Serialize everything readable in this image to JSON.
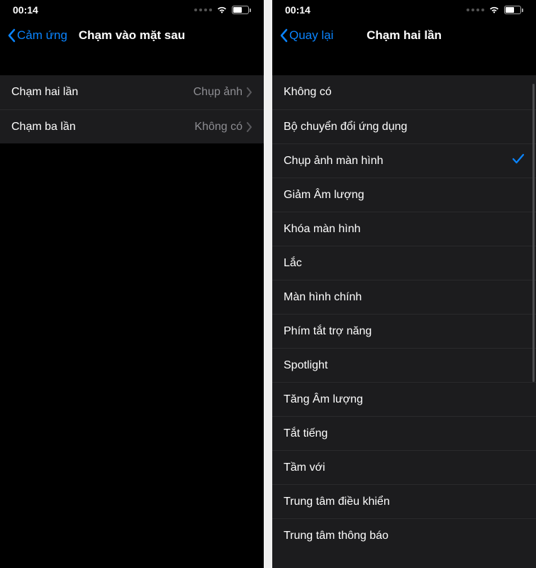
{
  "statusbar": {
    "time": "00:14"
  },
  "left": {
    "back_label": "Cảm ứng",
    "title": "Chạm vào mặt sau",
    "rows": [
      {
        "label": "Chạm hai lần",
        "value": "Chụp ảnh"
      },
      {
        "label": "Chạm ba lần",
        "value": "Không có"
      }
    ]
  },
  "right": {
    "back_label": "Quay lại",
    "title": "Chạm hai lần",
    "selected_index": 2,
    "options": [
      "Không có",
      "Bộ chuyển đổi ứng dụng",
      "Chụp ảnh màn hình",
      "Giảm Âm lượng",
      "Khóa màn hình",
      "Lắc",
      "Màn hình chính",
      "Phím tắt trợ năng",
      "Spotlight",
      "Tăng Âm lượng",
      "Tắt tiếng",
      "Tầm với",
      "Trung tâm điều khiển",
      "Trung tâm thông báo"
    ]
  }
}
